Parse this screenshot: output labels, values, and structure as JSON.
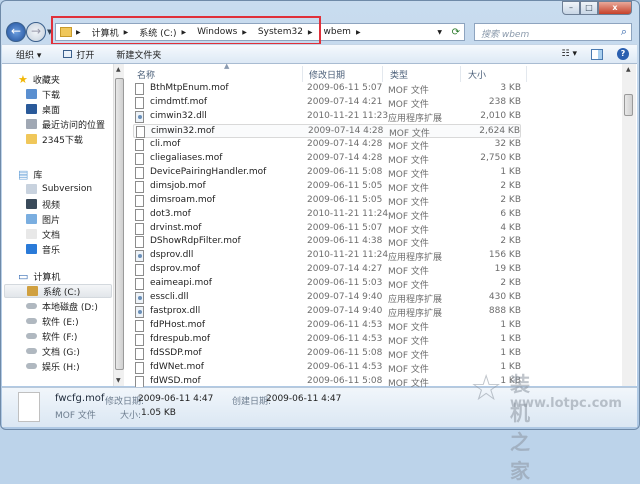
{
  "window": {
    "min_icon": "minimize-icon",
    "max_icon": "maximize-icon",
    "close_label": "x"
  },
  "address": {
    "crumbs": [
      "计算机",
      "系统 (C:)",
      "Windows",
      "System32",
      "wbem"
    ]
  },
  "search": {
    "placeholder": "搜索 wbem"
  },
  "toolbar": {
    "organize": "组织 ▾",
    "open": "打开",
    "new_folder": "新建文件夹",
    "views": "☷ ▾",
    "help": "?"
  },
  "sidebar": {
    "favorites": {
      "title": "收藏夹",
      "items": [
        "下载",
        "桌面",
        "最近访问的位置",
        "2345下载"
      ]
    },
    "libraries": {
      "title": "库",
      "items": [
        "Subversion",
        "视频",
        "图片",
        "文档",
        "音乐"
      ]
    },
    "computer": {
      "title": "计算机",
      "items": [
        "系统 (C:)",
        "本地磁盘 (D:)",
        "软件 (E:)",
        "软件 (F:)",
        "文档 (G:)",
        "娱乐 (H:)"
      ]
    }
  },
  "columns": {
    "name": "名称",
    "date": "修改日期",
    "type": "类型",
    "size": "大小"
  },
  "files": [
    {
      "name": "BthMtpEnum.mof",
      "date": "2009-06-11 5:07",
      "type": "MOF 文件",
      "size": "3 KB",
      "kind": "mof"
    },
    {
      "name": "cimdmtf.mof",
      "date": "2009-07-14 4:21",
      "type": "MOF 文件",
      "size": "238 KB",
      "kind": "mof"
    },
    {
      "name": "cimwin32.dll",
      "date": "2010-11-21 11:23",
      "type": "应用程序扩展",
      "size": "2,010 KB",
      "kind": "dll"
    },
    {
      "name": "cimwin32.mof",
      "date": "2009-07-14 4:28",
      "type": "MOF 文件",
      "size": "2,624 KB",
      "kind": "mof",
      "selected": true
    },
    {
      "name": "cli.mof",
      "date": "2009-07-14 4:28",
      "type": "MOF 文件",
      "size": "32 KB",
      "kind": "mof"
    },
    {
      "name": "cliegaliases.mof",
      "date": "2009-07-14 4:28",
      "type": "MOF 文件",
      "size": "2,750 KB",
      "kind": "mof"
    },
    {
      "name": "DevicePairingHandler.mof",
      "date": "2009-06-11 5:08",
      "type": "MOF 文件",
      "size": "1 KB",
      "kind": "mof"
    },
    {
      "name": "dimsjob.mof",
      "date": "2009-06-11 5:05",
      "type": "MOF 文件",
      "size": "2 KB",
      "kind": "mof"
    },
    {
      "name": "dimsroam.mof",
      "date": "2009-06-11 5:05",
      "type": "MOF 文件",
      "size": "2 KB",
      "kind": "mof"
    },
    {
      "name": "dot3.mof",
      "date": "2010-11-21 11:24",
      "type": "MOF 文件",
      "size": "6 KB",
      "kind": "mof"
    },
    {
      "name": "drvinst.mof",
      "date": "2009-06-11 5:07",
      "type": "MOF 文件",
      "size": "4 KB",
      "kind": "mof"
    },
    {
      "name": "DShowRdpFilter.mof",
      "date": "2009-06-11 4:38",
      "type": "MOF 文件",
      "size": "2 KB",
      "kind": "mof"
    },
    {
      "name": "dsprov.dll",
      "date": "2010-11-21 11:24",
      "type": "应用程序扩展",
      "size": "156 KB",
      "kind": "dll"
    },
    {
      "name": "dsprov.mof",
      "date": "2009-07-14 4:27",
      "type": "MOF 文件",
      "size": "19 KB",
      "kind": "mof"
    },
    {
      "name": "eaimeapi.mof",
      "date": "2009-06-11 5:03",
      "type": "MOF 文件",
      "size": "2 KB",
      "kind": "mof"
    },
    {
      "name": "esscli.dll",
      "date": "2009-07-14 9:40",
      "type": "应用程序扩展",
      "size": "430 KB",
      "kind": "dll"
    },
    {
      "name": "fastprox.dll",
      "date": "2009-07-14 9:40",
      "type": "应用程序扩展",
      "size": "888 KB",
      "kind": "dll"
    },
    {
      "name": "fdPHost.mof",
      "date": "2009-06-11 4:53",
      "type": "MOF 文件",
      "size": "1 KB",
      "kind": "mof"
    },
    {
      "name": "fdrespub.mof",
      "date": "2009-06-11 4:53",
      "type": "MOF 文件",
      "size": "1 KB",
      "kind": "mof"
    },
    {
      "name": "fdSSDP.mof",
      "date": "2009-06-11 5:08",
      "type": "MOF 文件",
      "size": "1 KB",
      "kind": "mof"
    },
    {
      "name": "fdWNet.mof",
      "date": "2009-06-11 4:53",
      "type": "MOF 文件",
      "size": "1 KB",
      "kind": "mof"
    },
    {
      "name": "fdWSD.mof",
      "date": "2009-06-11 5:08",
      "type": "MOF 文件",
      "size": "1 KB",
      "kind": "mof"
    }
  ],
  "status": {
    "filename": "fwcfg.mof",
    "modified_label": "修改日期:",
    "modified": "2009-06-11 4:47",
    "created_label": "创建日期:",
    "created": "2009-06-11 4:47",
    "type": "MOF 文件",
    "size_label": "大小:",
    "size": "1.05 KB"
  },
  "watermark": {
    "title": "装机之家",
    "url": "www.lotpc.com"
  },
  "colors": {
    "highlight": "#e0303a",
    "accent": "#2a5fb0"
  }
}
